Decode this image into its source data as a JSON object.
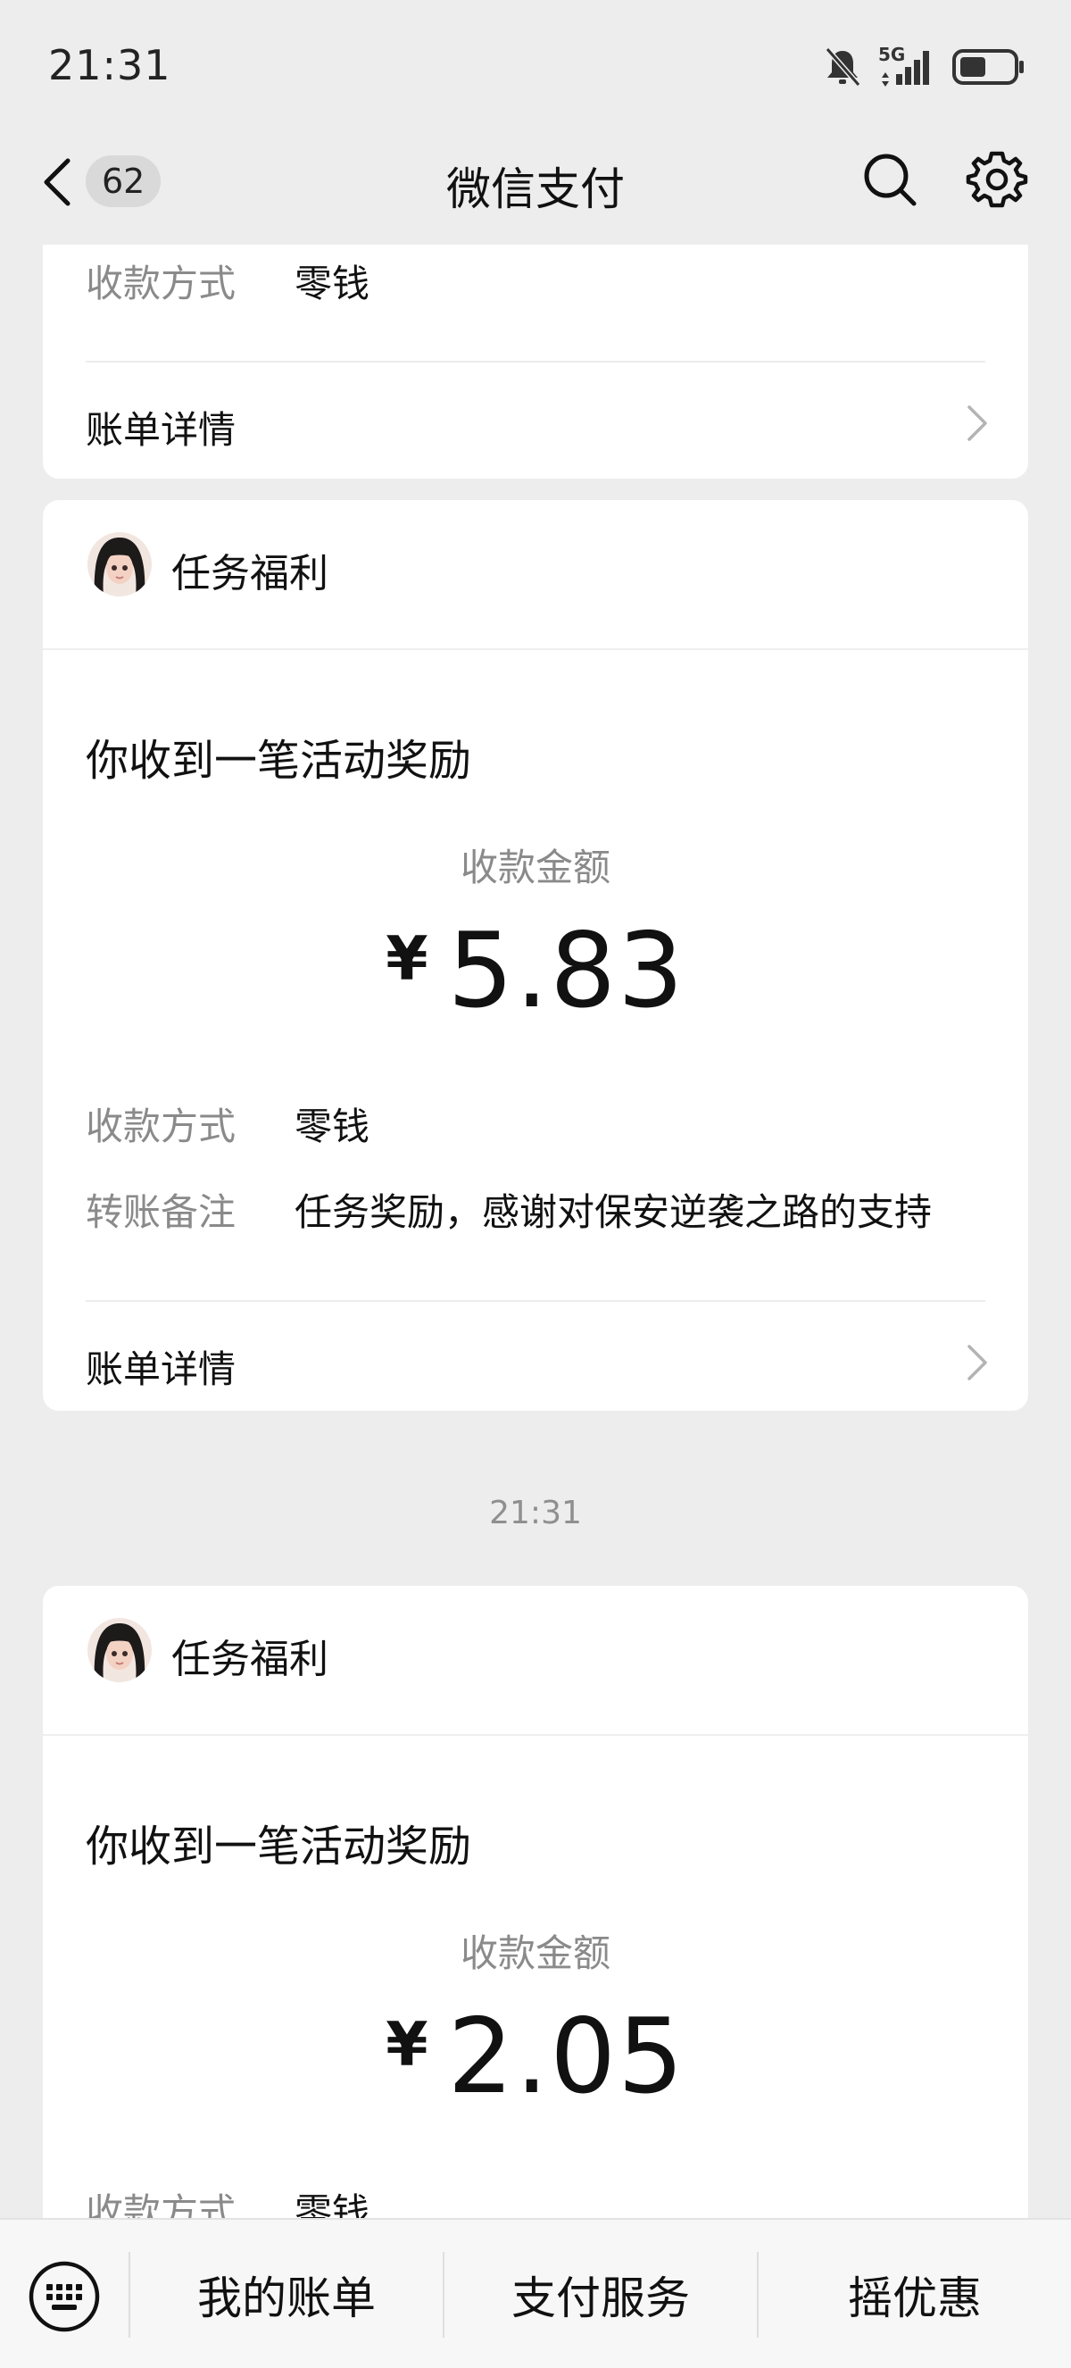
{
  "status_bar": {
    "time": "21:31",
    "network": "5G",
    "icons": [
      "mute-icon",
      "signal-icon",
      "battery-icon"
    ]
  },
  "nav": {
    "back_icon": "chevron-left-icon",
    "unread_count": "62",
    "title": "微信支付",
    "search_icon": "search-icon",
    "settings_icon": "gear-icon"
  },
  "messages": [
    {
      "partial": true,
      "method_label": "收款方式",
      "method_value": "零钱",
      "detail_link": "账单详情"
    },
    {
      "sender": "任务福利",
      "heading": "你收到一笔活动奖励",
      "amount_label": "收款金额",
      "currency": "¥",
      "amount": "5.83",
      "method_label": "收款方式",
      "method_value": "零钱",
      "note_label": "转账备注",
      "note_value": "任务奖励，感谢对保安逆袭之路的支持",
      "detail_link": "账单详情"
    },
    {
      "timestamp": "21:31",
      "sender": "任务福利",
      "heading": "你收到一笔活动奖励",
      "amount_label": "收款金额",
      "currency": "¥",
      "amount": "2.05",
      "method_label": "收款方式",
      "method_value": "零钱"
    }
  ],
  "bottom_bar": {
    "keyboard_icon": "keyboard-icon",
    "tabs": [
      "我的账单",
      "支付服务",
      "摇优惠"
    ]
  },
  "colors": {
    "background": "#ededed",
    "card": "#ffffff",
    "secondary_text": "#8a8a8a"
  }
}
